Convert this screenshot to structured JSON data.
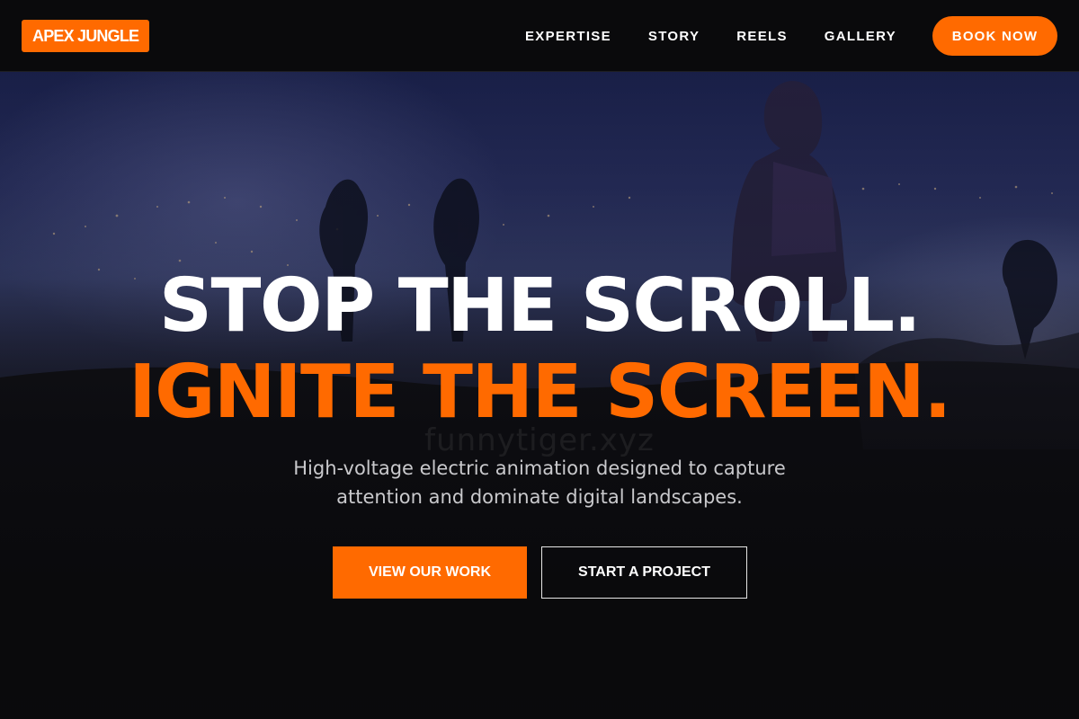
{
  "brand": {
    "logo_text": "APEX JUNGLE",
    "accent_color": "#ff6a00"
  },
  "nav": {
    "items": [
      {
        "label": "EXPERTISE"
      },
      {
        "label": "STORY"
      },
      {
        "label": "REELS"
      },
      {
        "label": "GALLERY"
      }
    ],
    "cta_label": "BOOK NOW"
  },
  "hero": {
    "background_image": "night-landscape-with-astronaut",
    "headline_line1": "STOP THE SCROLL.",
    "headline_line2": "IGNITE THE SCREEN.",
    "watermark": "funnytiger.xyz",
    "subtitle": "High-voltage electric animation designed to capture attention and dominate digital landscapes.",
    "primary_cta": "VIEW OUR WORK",
    "secondary_cta": "START A PROJECT"
  }
}
